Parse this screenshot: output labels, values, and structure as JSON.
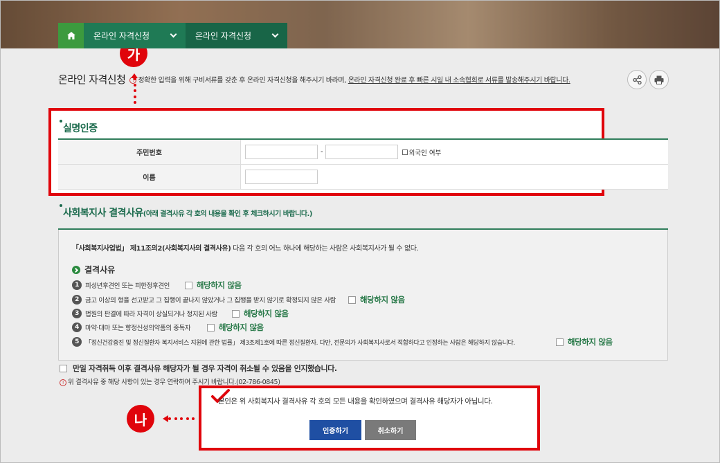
{
  "nav": {
    "home_icon": "home-icon",
    "items": [
      {
        "label": "온라인 자격신청"
      },
      {
        "label": "온라인 자격신청"
      }
    ]
  },
  "page": {
    "title": "온라인 자격신청",
    "notice_plain": "정확한 입력을 위해 구비서류를 갖춘 후 온라인 자격신청을 해주시기 바라며, ",
    "notice_underline": "온라인 자격신청 완료 후 빠른 시일 내 소속협회로 서류를 발송해주시기 바랍니다."
  },
  "tools": {
    "share_icon": "share-icon",
    "print_icon": "print-icon"
  },
  "markers": {
    "ga": "가",
    "na": "나"
  },
  "identity": {
    "title": "실명인증",
    "rows": [
      {
        "label": "주민번호",
        "separator": "-",
        "foreigner_label": "외국인 여부"
      },
      {
        "label": "이름"
      }
    ]
  },
  "reasons": {
    "title": "사회복지사 결격사유",
    "subtitle": "(아래 결격사유 각 호의 내용을 확인 후 체크하시기 바랍니다.)",
    "law_bold": "「사회복지사업법」 제11조의2(사회복지사의 결격사유)",
    "law_rest": " 다음 각 호의 어느 하나에 해당하는 사람은 사회복지사가 될 수 없다.",
    "heading": "결격사유",
    "not_applicable": "해당하지 않음",
    "items": [
      {
        "num": "1",
        "text": "피성년후견인 또는 피한정후견인"
      },
      {
        "num": "2",
        "text": "금고 이상의 형을 선고받고 그 집행이 끝나지 않았거나 그 집행을 받지 않기로 확정되지 않은 사람"
      },
      {
        "num": "3",
        "text": "법원의 판결에 따라 자격이 상실되거나 정지된 사람"
      },
      {
        "num": "4",
        "text": "마약·대마 또는 향정신성의약품의 중독자"
      },
      {
        "num": "5",
        "text": "「정신건강증진 및 정신질환자 복지서비스 지원에 관한 법률」 제3조제1호에 따른 정신질환자. 다만, 전문의가 사회복지사로서 적합하다고 인정하는 사람은 해당하지 않습니다."
      }
    ]
  },
  "agree": {
    "label": "만일 자격취득 이후 결격사유 해당자가 될 경우 자격이 취소될 수 있음을 인지했습니다.",
    "contact": "위 결격사유 중 해당 사항이 있는 경우 연락하여 주시기 바랍니다.(02-786-0845)"
  },
  "confirm": {
    "text": "본인은 위 사회복지사 결격사유 각 호의 모든 내용을 확인하였으며 결격사유 해당자가 아닙니다.",
    "ok_label": "인증하기",
    "cancel_label": "취소하기"
  },
  "colors": {
    "accent_red": "#e0040b",
    "brand_green": "#1c6b4d",
    "button_blue": "#1f4fa3",
    "button_gray": "#7a7a7a"
  }
}
